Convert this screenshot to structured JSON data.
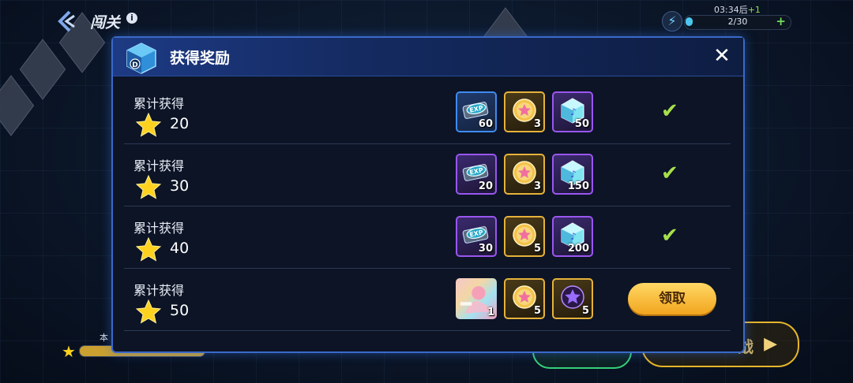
{
  "top_bar": {
    "title": "闯关",
    "info_icon": "i",
    "energy_timer": "03:34后",
    "energy_timer_plus": "+1",
    "energy_count": "2/30",
    "energy_fill_fraction": 0.067,
    "energy_add": "+"
  },
  "background": {
    "bottom_label": "本",
    "bottom_bar_fill_fraction": 1.0,
    "gold_button_partial": "战"
  },
  "modal": {
    "title": "获得奖励",
    "close": "✕",
    "rows": [
      {
        "label": "累计获得",
        "stars": "20",
        "rewards": [
          {
            "type": "exp-ticket",
            "frame": "blue",
            "count": "60"
          },
          {
            "type": "gold-coin",
            "frame": "gold",
            "count": "3"
          },
          {
            "type": "music-crystal",
            "frame": "purple",
            "count": "50"
          }
        ],
        "status": "claimed"
      },
      {
        "label": "累计获得",
        "stars": "30",
        "rewards": [
          {
            "type": "exp-ticket",
            "frame": "purple",
            "count": "20"
          },
          {
            "type": "gold-coin",
            "frame": "gold",
            "count": "3"
          },
          {
            "type": "music-crystal",
            "frame": "purple",
            "count": "150"
          }
        ],
        "status": "claimed"
      },
      {
        "label": "累计获得",
        "stars": "40",
        "rewards": [
          {
            "type": "exp-ticket",
            "frame": "purple",
            "count": "30"
          },
          {
            "type": "gold-coin",
            "frame": "gold",
            "count": "5"
          },
          {
            "type": "music-crystal",
            "frame": "purple",
            "count": "200"
          }
        ],
        "status": "claimed"
      },
      {
        "label": "累计获得",
        "stars": "50",
        "rewards": [
          {
            "type": "illustration-card",
            "frame": "none",
            "count": "1"
          },
          {
            "type": "gold-coin",
            "frame": "gold",
            "count": "5"
          },
          {
            "type": "purple-star-orb",
            "frame": "gold",
            "count": "5"
          }
        ],
        "status": "claimable",
        "claim_label": "领取"
      }
    ]
  },
  "colors": {
    "modal_border": "#3b69c8",
    "check": "#a7e04a",
    "claim_button": "#f2a51f",
    "star": "#ffd21f"
  }
}
